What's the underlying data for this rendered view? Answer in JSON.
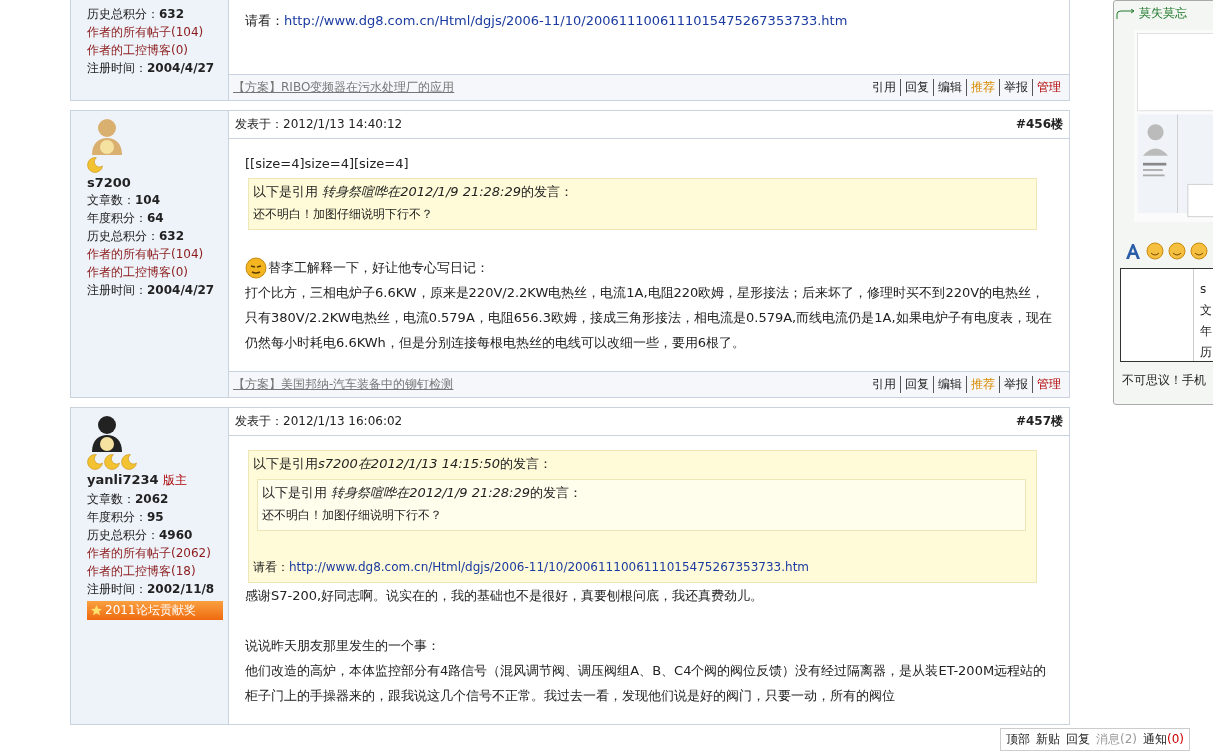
{
  "posts": [
    {
      "author": {
        "stats": [
          {
            "kind": "stat",
            "label": "历史总积分：",
            "value": "632"
          },
          {
            "kind": "link",
            "label": "作者的所有帖子(104)"
          },
          {
            "kind": "link",
            "label": "作者的工控博客(0)"
          },
          {
            "kind": "stat",
            "label": "注册时间：",
            "value": "2004/4/27"
          }
        ]
      },
      "blocks": [
        {
          "kind": "link",
          "label": "请看：",
          "url": "http://www.dg8.com.cn/Html/dgjs/2006-11/10/2006111006111015475267353733.htm"
        }
      ],
      "footer": "【方案】RIBO变频器在污水处理厂的应用",
      "actions": [
        {
          "label": "引用",
          "kind": "plain"
        },
        {
          "label": "回复",
          "kind": "plain"
        },
        {
          "label": "编辑",
          "kind": "plain"
        },
        {
          "label": "推荐",
          "kind": "highlight"
        },
        {
          "label": "举报",
          "kind": "plain"
        },
        {
          "label": "管理",
          "kind": "admin"
        }
      ]
    },
    {
      "author": {
        "rank": [
          {
            "kind": "moon"
          }
        ],
        "name": "s7200",
        "stats": [
          {
            "kind": "stat",
            "label": "文章数：",
            "value": "104"
          },
          {
            "kind": "stat",
            "label": "年度积分：",
            "value": "64"
          },
          {
            "kind": "stat",
            "label": "历史总积分：",
            "value": "632"
          },
          {
            "kind": "link",
            "label": "作者的所有帖子(104)"
          },
          {
            "kind": "link",
            "label": "作者的工控博客(0)"
          },
          {
            "kind": "stat",
            "label": "注册时间：",
            "value": "2004/4/27"
          }
        ]
      },
      "time": "发表于：2012/1/13 14:40:12",
      "floor": "#456楼",
      "blocks": [
        {
          "kind": "text",
          "text": "[[size=4]size=4][size=4]"
        },
        {
          "kind": "quote",
          "header": {
            "prefix": "以下是引用 ",
            "source": "转身祭喧哗在2012/1/9 21:28:29",
            "suffix": "的发言："
          },
          "blocks": [
            {
              "kind": "small",
              "text": "还不明白！加图仔细说明下行不？"
            }
          ]
        },
        {
          "kind": "emote",
          "gap": true,
          "text": "替李工解释一下，好让他专心写日记："
        },
        {
          "kind": "text",
          "text": "打个比方，三相电炉子6.6KW，原来是220V/2.2KW电热丝，电流1A,电阻220欧姆，星形接法；后来坏了，修理时买不到220V的电热丝，只有380V/2.2KW电热丝，电流0.579A，电阻656.3欧姆，接成三角形接法，相电流是0.579A,而线电流仍是1A,如果电炉子有电度表，现在仍然每小时耗电6.6KWh，但是分别连接每根电热丝的电线可以改细一些，要用6根了。"
        }
      ],
      "footer": "【方案】美国邦纳-汽车装备中的铆钉检测",
      "actions": [
        {
          "label": "引用",
          "kind": "plain"
        },
        {
          "label": "回复",
          "kind": "plain"
        },
        {
          "label": "编辑",
          "kind": "plain"
        },
        {
          "label": "推荐",
          "kind": "highlight"
        },
        {
          "label": "举报",
          "kind": "plain"
        },
        {
          "label": "管理",
          "kind": "admin"
        }
      ]
    },
    {
      "author": {
        "rank": [
          {
            "kind": "moon"
          },
          {
            "kind": "moon"
          },
          {
            "kind": "moon"
          }
        ],
        "name": "yanli7234",
        "role": "版主",
        "stats": [
          {
            "kind": "stat",
            "label": "文章数：",
            "value": "2062"
          },
          {
            "kind": "stat",
            "label": "年度积分：",
            "value": "95"
          },
          {
            "kind": "stat",
            "label": "历史总积分：",
            "value": "4960"
          },
          {
            "kind": "link",
            "label": "作者的所有帖子(2062)"
          },
          {
            "kind": "link",
            "label": "作者的工控博客(18)"
          },
          {
            "kind": "stat",
            "label": "注册时间：",
            "value": "2002/11/8"
          }
        ],
        "award": "2011论坛贡献奖"
      },
      "time": "发表于：2012/1/13 16:06:02",
      "floor": "#457楼",
      "blocks": [
        {
          "kind": "quote",
          "header": {
            "prefix": "以下是引用",
            "source": "s7200在2012/1/13 14:15:50",
            "suffix": "的发言："
          },
          "blocks": [
            {
              "kind": "quote",
              "header": {
                "prefix": "以下是引用 ",
                "source": "转身祭喧哗在2012/1/9 21:28:29",
                "suffix": "的发言："
              },
              "blocks": [
                {
                  "kind": "small",
                  "text": "还不明白！加图仔细说明下行不？"
                }
              ]
            },
            {
              "kind": "link",
              "small": true,
              "gap": true,
              "label": "请看：",
              "url": "http://www.dg8.com.cn/Html/dgjs/2006-11/10/2006111006111015475267353733.htm"
            }
          ]
        },
        {
          "kind": "text",
          "text": "感谢S7-200,好同志啊。说实在的，我的基础也不是很好，真要刨根问底，我还真费劲儿。"
        },
        {
          "kind": "text",
          "gap": true,
          "text": "说说昨天朋友那里发生的一个事："
        },
        {
          "kind": "text",
          "text": "他们改造的高炉，本体监控部分有4路信号（混风调节阀、调压阀组A、B、C4个阀的阀位反馈）没有经过隔离器，是从装ET-200M远程站的柜子门上的手操器来的，跟我说这几个信号不正常。我过去一看，发现他们说是好的阀门，只要一动，所有的阀位"
        }
      ]
    }
  ],
  "popup": {
    "title": "莫失莫忘",
    "preview": {
      "kind": "picture"
    },
    "side_chars": [
      "s",
      "文",
      "年",
      "历"
    ],
    "caption": "不可思议！手机"
  },
  "float_bar": [
    {
      "label": "顶部",
      "disabled": false
    },
    {
      "label": "新贴",
      "disabled": false
    },
    {
      "label": "回复",
      "disabled": false
    },
    {
      "label": "消息(2)",
      "disabled": true
    },
    {
      "label": "通知",
      "count": "(0)",
      "disabled": false
    }
  ]
}
